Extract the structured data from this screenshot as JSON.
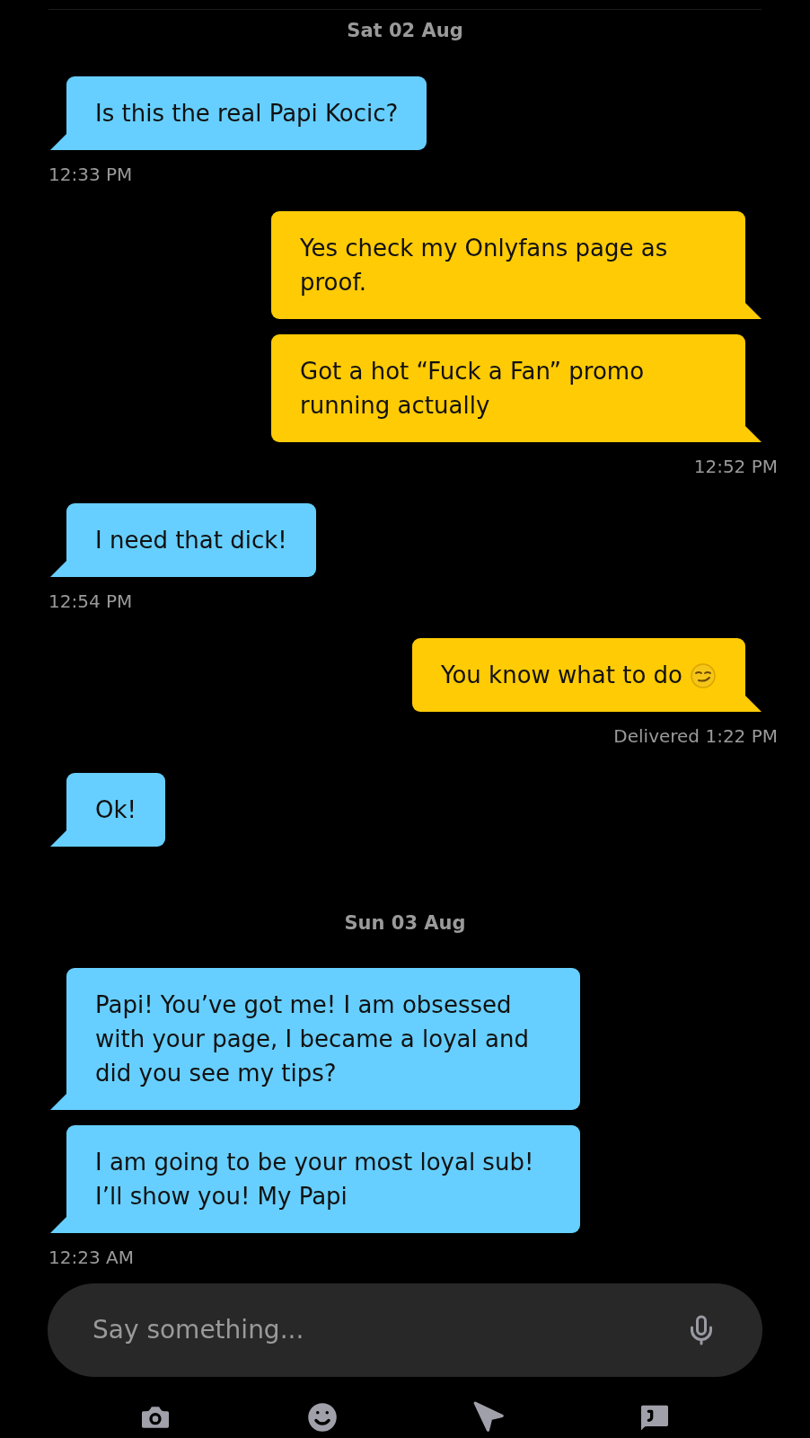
{
  "items": [
    {
      "kind": "date",
      "text": "Sat 02 Aug"
    },
    {
      "kind": "message",
      "outgoing": false,
      "text": "Is this the real Papi Kocic?"
    },
    {
      "kind": "meta",
      "text": "12:33 PM"
    },
    {
      "kind": "message",
      "outgoing": true,
      "text": "Yes check my Onlyfans page as proof."
    },
    {
      "kind": "message",
      "outgoing": true,
      "text": "Got a hot “Fuck a Fan” promo running actually"
    },
    {
      "kind": "meta",
      "text": "12:52 PM"
    },
    {
      "kind": "message",
      "outgoing": false,
      "text": "I need that dick!"
    },
    {
      "kind": "meta",
      "text": "12:54 PM"
    },
    {
      "kind": "message",
      "outgoing": true,
      "text": "You know what to do",
      "emoji": true
    },
    {
      "kind": "meta",
      "text": "Delivered 1:22 PM"
    },
    {
      "kind": "message",
      "outgoing": false,
      "text": "Ok!"
    },
    {
      "kind": "date",
      "text": "Sun 03 Aug"
    },
    {
      "kind": "message",
      "outgoing": false,
      "text": "Papi! You’ve got me! I am obsessed with your page, I became a loyal and did you see my tips?"
    },
    {
      "kind": "message",
      "outgoing": false,
      "text": "I am going to be your most loyal sub! I’ll show you! My Papi"
    },
    {
      "kind": "meta",
      "text": "12:23 AM"
    }
  ],
  "composer": {
    "placeholder": "Say something..."
  }
}
